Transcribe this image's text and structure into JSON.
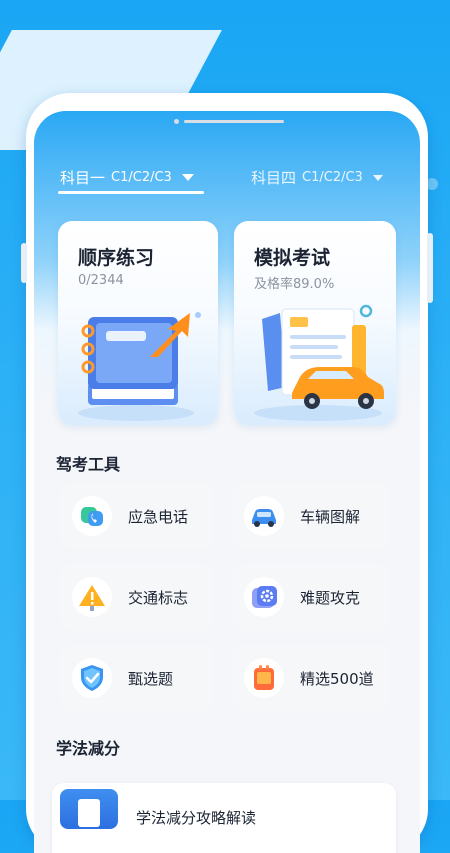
{
  "tabs": [
    {
      "title": "科目一",
      "sub": "C1/C2/C3"
    },
    {
      "title": "科目四",
      "sub": "C1/C2/C3"
    }
  ],
  "cards": [
    {
      "title": "顺序练习",
      "sub": "0/2344"
    },
    {
      "title": "模拟考试",
      "sub": "及格率89.0%"
    }
  ],
  "tools_section": {
    "title": "驾考工具"
  },
  "tools": [
    {
      "label": "应急电话",
      "icon": "phone-icon"
    },
    {
      "label": "车辆图解",
      "icon": "car-icon"
    },
    {
      "label": "交通标志",
      "icon": "warning-sign-icon"
    },
    {
      "label": "难题攻克",
      "icon": "gear-icon"
    },
    {
      "label": "甄选题",
      "icon": "shield-check-icon"
    },
    {
      "label": "精选500道",
      "icon": "book-500-icon"
    }
  ],
  "law_section": {
    "title": "学法减分"
  },
  "law_item": {
    "label": "学法减分攻略解读"
  },
  "colors": {
    "brand": "#1aa6f4",
    "text": "#1c2433",
    "muted": "#8a93a0"
  }
}
